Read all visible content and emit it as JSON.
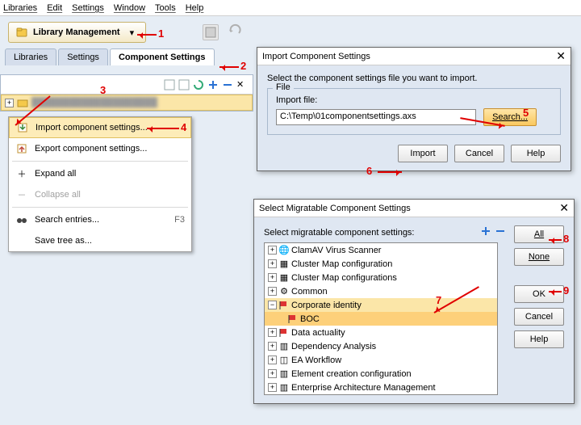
{
  "menubar": [
    "Libraries",
    "Edit",
    "Settings",
    "Window",
    "Tools",
    "Help"
  ],
  "library_button": "Library Management",
  "tabs": {
    "libraries": "Libraries",
    "settings": "Settings",
    "component": "Component Settings"
  },
  "context_menu": {
    "import": "Import component settings...",
    "export": "Export component settings...",
    "expand": "Expand all",
    "collapse": "Collapse all",
    "search": "Search entries...",
    "search_shortcut": "F3",
    "savetree": "Save tree as..."
  },
  "import_dialog": {
    "title": "Import Component Settings",
    "instruction": "Select the component settings file you want to import.",
    "fieldset": "File",
    "label": "Import file:",
    "value": "C:\\Temp\\01componentsettings.axs",
    "search": "Search...",
    "import": "Import",
    "cancel": "Cancel",
    "help": "Help"
  },
  "select_dialog": {
    "title": "Select Migratable Component Settings",
    "instruction": "Select migratable component settings:",
    "all": "All",
    "none": "None",
    "ok": "OK",
    "cancel": "Cancel",
    "help": "Help",
    "nodes": {
      "n0": "ClamAV Virus Scanner",
      "n1": "Cluster Map configuration",
      "n2": "Cluster Map configurations",
      "n3": "Common",
      "n4": "Corporate identity",
      "n4a": "BOC",
      "n5": "Data actuality",
      "n6": "Dependency Analysis",
      "n7": "EA Workflow",
      "n8": "Element creation configuration",
      "n9": "Enterprise Architecture Management"
    }
  },
  "markers": {
    "m1": "1",
    "m2": "2",
    "m3": "3",
    "m4": "4",
    "m5": "5",
    "m6": "6",
    "m7": "7",
    "m8": "8",
    "m9": "9"
  }
}
